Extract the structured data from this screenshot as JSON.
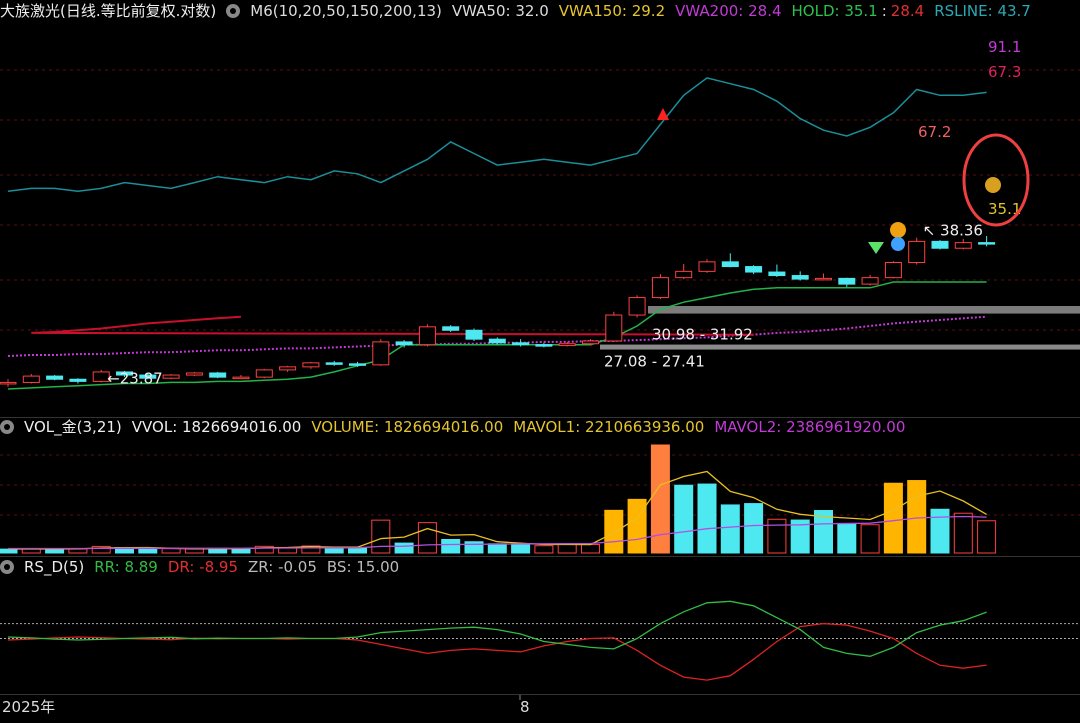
{
  "header": {
    "stock_title": "大族激光(日线.等比前复权.对数)",
    "ma_label": "M6(10,20,50,150,200,13)",
    "vwa50": "VWA50: 32.0",
    "vwa150": "VWA150: 29.2",
    "vwa200": "VWA200: 28.4",
    "hold": "HOLD: 35.1",
    "hold_sep": ":",
    "hold2": "28.4",
    "rsline": "RSLINE: 43.7"
  },
  "vol_header": {
    "title": "VOL_金(3,21)",
    "vvol": "VVOL: 1826694016.00",
    "volume": "VOLUME: 1826694016.00",
    "mavol1": "MAVOL1: 2210663936.00",
    "mavol2": "MAVOL2: 2386961920.00"
  },
  "rs_header": {
    "title": "RS_D(5)",
    "rr": "RR: 8.89",
    "dr": "DR: -8.95",
    "zr": "ZR: -0.05",
    "bs": "BS: 15.00"
  },
  "x_axis": {
    "year_label": "2025年",
    "month_label": "8"
  },
  "colors": {
    "up": "#ff4040",
    "down": "#4de8f0",
    "hold": "#22b34a",
    "rsline": "#1a8f9a",
    "vwa200": "#c23bd6",
    "vwa50": "#c8102e",
    "vol_hi": "#ffb400",
    "vol_peak": "#ff7f3f",
    "ma1": "#e8c020",
    "ma2": "#b44fe0",
    "rr": "#33bb44",
    "dr": "#dd2222",
    "zone": "#8a8a8a",
    "annot": "#f06060"
  },
  "chart_data": [
    {
      "type": "candlestick",
      "title": "大族激光(日线.等比前复权.对数)",
      "scale": "log",
      "ylim": [
        21,
        98
      ],
      "price_labels": [
        "23.87",
        "30.98 - 31.92",
        "27.08 - 27.41",
        "38.36",
        "67.2",
        "35.1",
        "91.1",
        "67.3"
      ],
      "zones": [
        {
          "label": "30.98 - 31.92",
          "low": 30.98,
          "high": 31.92
        },
        {
          "label": "27.08 - 27.41",
          "low": 27.08,
          "high": 27.41
        }
      ],
      "candles": [
        [
          23.5,
          23.6,
          23.9,
          23.2
        ],
        [
          23.6,
          24.2,
          24.4,
          23.5
        ],
        [
          24.2,
          23.9,
          24.3,
          23.8
        ],
        [
          23.9,
          23.7,
          24.0,
          23.5
        ],
        [
          23.7,
          24.6,
          24.8,
          23.6
        ],
        [
          24.6,
          24.3,
          24.7,
          24.1
        ],
        [
          24.3,
          24.0,
          24.4,
          23.9
        ],
        [
          24.0,
          24.3,
          24.4,
          23.9
        ],
        [
          24.3,
          24.5,
          24.6,
          24.2
        ],
        [
          24.5,
          24.1,
          24.6,
          24.0
        ],
        [
          24.1,
          24.1,
          24.3,
          24.0
        ],
        [
          24.1,
          24.8,
          24.9,
          24.0
        ],
        [
          24.8,
          25.1,
          25.2,
          24.6
        ],
        [
          25.1,
          25.5,
          25.6,
          24.9
        ],
        [
          25.5,
          25.4,
          25.7,
          25.2
        ],
        [
          25.4,
          25.3,
          25.6,
          25.1
        ],
        [
          25.3,
          27.7,
          28.0,
          25.2
        ],
        [
          27.7,
          27.4,
          27.9,
          27.1
        ],
        [
          27.4,
          29.4,
          29.7,
          27.2
        ],
        [
          29.4,
          29.0,
          29.6,
          28.8
        ],
        [
          29.0,
          28.0,
          29.2,
          27.8
        ],
        [
          28.0,
          27.6,
          28.2,
          27.4
        ],
        [
          27.6,
          27.4,
          28.0,
          27.2
        ],
        [
          27.4,
          27.3,
          27.6,
          27.1
        ],
        [
          27.3,
          27.5,
          27.7,
          27.2
        ],
        [
          27.5,
          27.8,
          28.0,
          27.3
        ],
        [
          27.8,
          30.8,
          31.2,
          27.7
        ],
        [
          30.8,
          33.0,
          33.3,
          30.5
        ],
        [
          33.0,
          35.7,
          36.2,
          32.8
        ],
        [
          35.7,
          36.6,
          37.7,
          35.5
        ],
        [
          36.6,
          38.0,
          38.4,
          36.4
        ],
        [
          38.0,
          37.3,
          39.3,
          37.2
        ],
        [
          37.3,
          36.5,
          37.5,
          36.2
        ],
        [
          36.5,
          36.0,
          37.6,
          35.8
        ],
        [
          36.0,
          35.5,
          36.6,
          35.3
        ],
        [
          35.5,
          35.6,
          36.3,
          35.3
        ],
        [
          35.6,
          34.8,
          35.7,
          34.4
        ],
        [
          34.8,
          35.7,
          36.1,
          34.6
        ],
        [
          35.7,
          37.9,
          38.1,
          35.6
        ],
        [
          37.9,
          41.2,
          41.8,
          37.6
        ],
        [
          41.2,
          40.1,
          41.4,
          39.9
        ],
        [
          40.1,
          41.0,
          41.6,
          39.9
        ],
        [
          41.0,
          40.8,
          42.1,
          40.4
        ]
      ],
      "series": [
        {
          "name": "HOLD",
          "values": [
            23.0,
            23.1,
            23.2,
            23.3,
            23.4,
            23.5,
            23.5,
            23.6,
            23.6,
            23.7,
            23.7,
            23.8,
            23.9,
            24.1,
            24.6,
            25.2,
            25.8,
            27.4,
            27.4,
            27.4,
            27.4,
            27.4,
            27.4,
            27.4,
            27.4,
            27.4,
            28.2,
            29.5,
            31.5,
            32.4,
            33.0,
            33.6,
            34.1,
            34.3,
            34.3,
            34.3,
            34.3,
            34.3,
            35.1,
            35.1,
            35.1,
            35.1,
            35.1
          ]
        },
        {
          "name": "VWA200",
          "values": [
            26.2,
            26.3,
            26.3,
            26.4,
            26.4,
            26.5,
            26.6,
            26.6,
            26.7,
            26.8,
            26.8,
            26.9,
            27.0,
            27.0,
            27.1,
            27.2,
            27.3,
            27.4,
            27.4,
            27.5,
            27.5,
            27.6,
            27.6,
            27.7,
            27.7,
            27.8,
            27.8,
            27.9,
            28.0,
            28.1,
            28.2,
            28.4,
            28.5,
            28.7,
            28.8,
            29.0,
            29.2,
            29.5,
            29.8,
            30.0,
            30.2,
            30.4,
            30.6
          ]
        },
        {
          "name": "RSLINE",
          "values": [
            55,
            56,
            56,
            55,
            56,
            58,
            57,
            56,
            58,
            60,
            59,
            58,
            60,
            59,
            62,
            61,
            58,
            62,
            66,
            72,
            68,
            64,
            65,
            66,
            65,
            64,
            66,
            68,
            78,
            88,
            94,
            92,
            90,
            86,
            80,
            76,
            74,
            77,
            82,
            90,
            88,
            88,
            89
          ]
        }
      ]
    },
    {
      "type": "bar",
      "title": "VOL_金(3,21)",
      "values": [
        4.3,
        4.5,
        4.8,
        4.6,
        7.3,
        6.1,
        4.8,
        4.8,
        4.5,
        5.1,
        4.8,
        7.4,
        6.2,
        7.8,
        5.7,
        5.6,
        36.5,
        11.0,
        33.7,
        15.0,
        12.5,
        10.2,
        10.1,
        8.1,
        10.3,
        9.4,
        47.4,
        59.6,
        120.0,
        75.3,
        76.6,
        53.4,
        54.9,
        37.5,
        36.6,
        47.2,
        32.9,
        31.4,
        77.5,
        80.5,
        48.6,
        44.2,
        35.8
      ],
      "colors": [
        "c",
        "u",
        "c",
        "u",
        "u",
        "c",
        "c",
        "u",
        "u",
        "c",
        "c",
        "u",
        "u",
        "u",
        "c",
        "c",
        "u",
        "c",
        "u",
        "c",
        "c",
        "c",
        "c",
        "u",
        "u",
        "u",
        "y",
        "y",
        "p",
        "c",
        "c",
        "c",
        "c",
        "u",
        "c",
        "c",
        "c",
        "u",
        "y",
        "y",
        "c",
        "u",
        "u"
      ],
      "series": [
        {
          "name": "MAVOL1",
          "values": [
            4.5,
            4.5,
            4.5,
            4.6,
            5.6,
            6.0,
            6.1,
            5.2,
            4.7,
            4.8,
            4.8,
            5.8,
            6.1,
            7.1,
            6.6,
            6.4,
            16.0,
            17.7,
            27.1,
            19.9,
            20.4,
            12.6,
            10.9,
            9.5,
            9.5,
            9.3,
            22.4,
            38.8,
            75.7,
            85.0,
            90.6,
            68.4,
            61.6,
            48.6,
            43.0,
            40.4,
            38.9,
            37.2,
            47.3,
            63.1,
            68.9,
            57.8,
            42.9
          ]
        },
        {
          "name": "MAVOL2",
          "values": [
            5.0,
            5.0,
            5.0,
            5.0,
            5.1,
            5.2,
            5.2,
            5.2,
            5.2,
            5.2,
            5.2,
            5.4,
            5.5,
            5.7,
            5.8,
            5.8,
            7.3,
            7.6,
            9.0,
            9.4,
            9.7,
            9.9,
            10.1,
            10.2,
            10.4,
            10.5,
            12.6,
            15.1,
            20.3,
            23.5,
            27.0,
            28.8,
            30.5,
            31.0,
            31.3,
            32.3,
            32.8,
            33.1,
            35.9,
            38.9,
            39.9,
            40.6,
            39.9
          ]
        }
      ]
    },
    {
      "type": "line",
      "title": "RS_D(5)",
      "ylim": [
        -18,
        18
      ],
      "series": [
        {
          "name": "RR",
          "values": [
            0.5,
            0.2,
            -0.2,
            -0.5,
            -0.3,
            0.0,
            0.2,
            0.4,
            -0.1,
            0.1,
            0.0,
            0.0,
            0.2,
            0.0,
            0.0,
            0.5,
            2.0,
            2.5,
            3.0,
            3.5,
            3.8,
            3.0,
            1.5,
            -1.0,
            -2.0,
            -3.0,
            -3.5,
            0.0,
            5.0,
            9.0,
            12.0,
            12.5,
            11.0,
            7.0,
            3.0,
            -3.0,
            -5.0,
            -6.0,
            -3.0,
            2.0,
            4.5,
            6.0,
            8.89
          ]
        },
        {
          "name": "DR",
          "values": [
            -0.5,
            -0.2,
            0.2,
            0.5,
            0.3,
            0.0,
            -0.2,
            -0.4,
            0.1,
            -0.1,
            0.0,
            0.0,
            -0.2,
            0.0,
            0.0,
            -0.5,
            -2.0,
            -3.5,
            -5.0,
            -4.0,
            -3.5,
            -4.0,
            -4.5,
            -2.5,
            -1.0,
            0.0,
            0.2,
            -4.0,
            -9.0,
            -13.0,
            -14.0,
            -12.5,
            -7.0,
            -1.0,
            4.0,
            5.0,
            4.5,
            2.5,
            0.0,
            -5.0,
            -9.0,
            -10.0,
            -8.95
          ]
        }
      ],
      "reference_lines": [
        5,
        0
      ]
    }
  ]
}
